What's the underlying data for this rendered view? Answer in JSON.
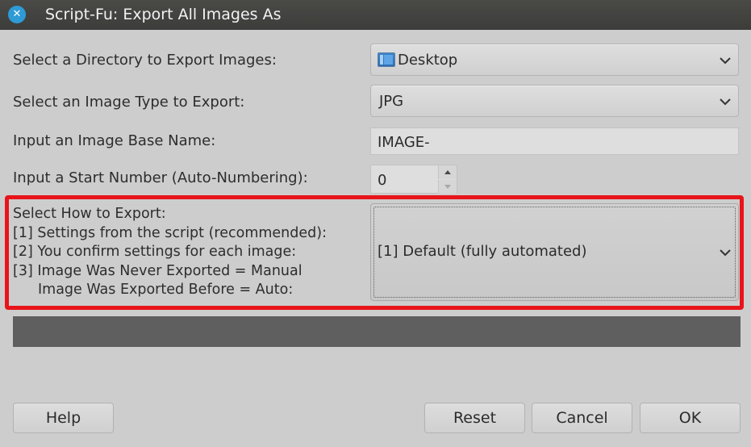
{
  "window": {
    "title": "Script-Fu: Export All Images As"
  },
  "fields": {
    "directory_label": "Select a Directory to Export Images:",
    "directory_value": "Desktop",
    "type_label": "Select an Image Type to Export:",
    "type_value": "JPG",
    "basename_label": "Input an Image Base Name:",
    "basename_value": "IMAGE-",
    "start_label": "Input a Start Number (Auto-Numbering):",
    "start_value": "0",
    "export_label_lines": [
      "Select How to Export:",
      "[1] Settings from the script (recommended):",
      "[2] You confirm settings for each image:",
      "[3] Image Was Never Exported = Manual",
      "Image Was Exported Before = Auto:"
    ],
    "export_value": "[1] Default (fully automated)"
  },
  "buttons": {
    "help": "Help",
    "reset": "Reset",
    "cancel": "Cancel",
    "ok": "OK"
  },
  "icons": {
    "close": "close-icon",
    "folder": "desktop-folder-icon",
    "dropdown": "chevron-down-icon",
    "spin_up": "arrow-up-icon",
    "spin_down": "arrow-down-icon"
  },
  "colors": {
    "accent_close": "#2e9bd6",
    "highlight": "#e8141a",
    "titlebar": "#3c3c3a"
  }
}
